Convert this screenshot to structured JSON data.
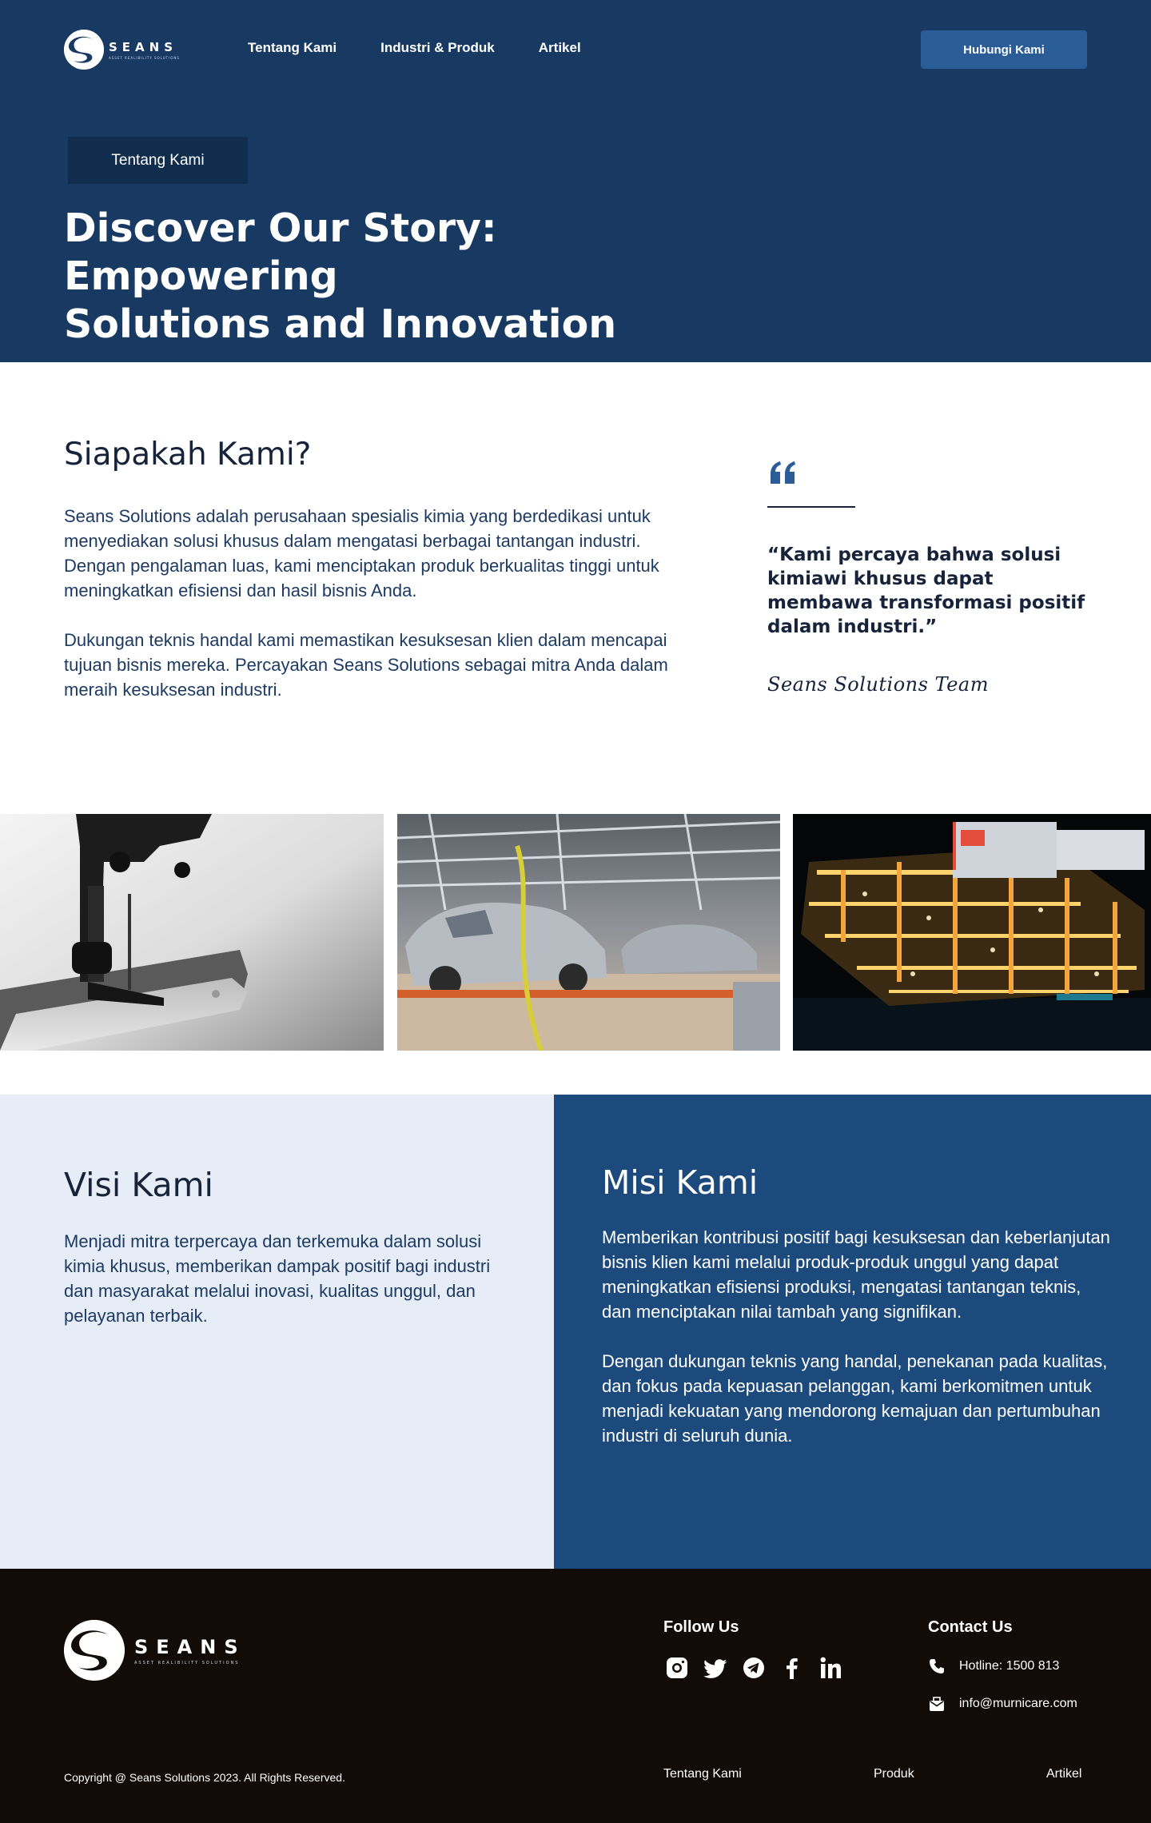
{
  "brand": {
    "name": "SEANS",
    "tagline": "ASSET REALIBILITY SOLUTIONS",
    "colors": {
      "navy": "#183a62",
      "accent": "#2a5d98",
      "mission_bg": "#1d4a7c",
      "vision_bg": "#e6edf6",
      "footer_bg": "#120c09"
    }
  },
  "header": {
    "nav": [
      "Tentang Kami",
      "Industri & Produk",
      "Artikel"
    ],
    "cta_label": "Hubungi Kami"
  },
  "hero": {
    "tag": "Tentang Kami",
    "title_line1": "Discover Our Story: Empowering",
    "title_line2": "Solutions and Innovation"
  },
  "about": {
    "title": "Siapakah Kami?",
    "paragraphs": [
      "Seans Solutions adalah perusahaan spesialis kimia yang berdedikasi untuk menyediakan solusi khusus dalam mengatasi berbagai tantangan industri. Dengan pengalaman luas, kami menciptakan produk berkualitas tinggi untuk meningkatkan efisiensi dan hasil bisnis Anda.",
      "Dukungan teknis handal kami memastikan kesuksesan klien dalam mencapai tujuan bisnis mereka. Percayakan Seans Solutions sebagai mitra Anda dalam meraih kesuksesan industri."
    ],
    "quote_icon": "quote-icon",
    "quote": "“Kami percaya bahwa solusi kimiawi khusus dapat membawa transformasi positif dalam industri.”",
    "signature": "Seans Solutions Team"
  },
  "photos": [
    "sewing-machine-photo",
    "car-factory-photo",
    "offshore-platform-photo"
  ],
  "vision": {
    "title": "Visi Kami",
    "body": "Menjadi mitra terpercaya dan terkemuka dalam solusi kimia khusus, memberikan dampak positif bagi industri dan masyarakat melalui inovasi, kualitas unggul, dan pelayanan terbaik."
  },
  "mission": {
    "title": "Misi Kami",
    "paragraphs": [
      "Memberikan kontribusi positif bagi kesuksesan dan keberlanjutan bisnis klien kami melalui produk-produk unggul yang dapat meningkatkan efisiensi produksi, mengatasi tantangan teknis, dan menciptakan nilai tambah yang signifikan.",
      "Dengan dukungan teknis yang handal, penekanan pada kualitas, dan fokus pada kepuasan pelanggan, kami berkomitmen untuk menjadi kekuatan yang mendorong kemajuan dan pertumbuhan industri di seluruh dunia."
    ]
  },
  "footer": {
    "follow_title": "Follow Us",
    "socials": [
      "instagram-icon",
      "twitter-icon",
      "telegram-icon",
      "facebook-icon",
      "linkedin-icon"
    ],
    "contact_title": "Contact Us",
    "hotline": "Hotline: 1500 813",
    "email": "info@murnicare.com",
    "copyright": "Copyright @ Seans Solutions 2023. All Rights Reserved.",
    "links": [
      "Tentang Kami",
      "Produk",
      "Artikel"
    ]
  }
}
